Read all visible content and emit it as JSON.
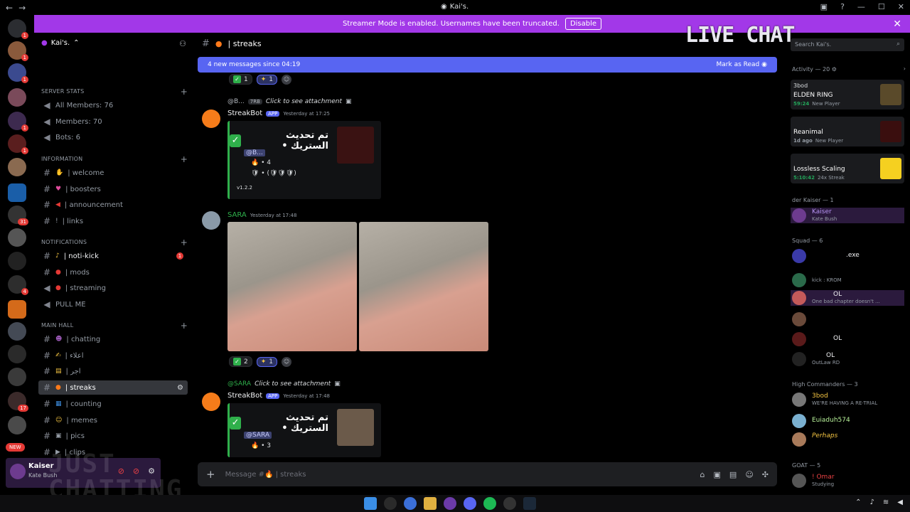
{
  "window": {
    "title": "Kai's.",
    "back": "←",
    "forward": "→"
  },
  "banner": {
    "text": "Streamer Mode is enabled. Usernames have been truncated.",
    "button": "Disable",
    "close": "✕"
  },
  "servers": {
    "new_label": "NEW",
    "badges": [
      "1",
      "1",
      "1",
      "1",
      "1",
      "31",
      "4",
      "17"
    ]
  },
  "guild": {
    "name": "Kai's.",
    "categories": {
      "server_stats": "SERVER STATS",
      "information": "INFORMATION",
      "notifications": "NOTIFICATIONS",
      "main_hall": "MAIN HALL"
    },
    "stats": [
      "All Members: 76",
      "Members: 70",
      "Bots: 6"
    ],
    "info_channels": [
      "| welcome",
      "| boosters",
      "| announcement",
      "| links"
    ],
    "notif_channels": [
      "| noti-kick",
      "| mods",
      "| streaming",
      "PULL ME"
    ],
    "notif_badge": "1",
    "hall_channels": [
      "| chatting",
      "| اعلاء",
      "| اجر",
      "| streaks",
      "| counting",
      "| memes",
      "| pics",
      "| clips"
    ]
  },
  "user": {
    "name": "Kaiser",
    "status": "Kate Bush"
  },
  "watermark": {
    "line1": "JUST",
    "line2": "CHATTING"
  },
  "chat": {
    "channel": "| streaks",
    "new_messages": "4 new messages since 04:19",
    "mark_read": "Mark as Read",
    "placeholder": "Message #🔥 | streaks",
    "react1": {
      "count1": "1",
      "count2": "1"
    },
    "msg1": {
      "reply_user": "@B...",
      "reply_tag": "7RB",
      "reply_text": "Click to see attachment",
      "author": "StreakBot",
      "app": "APP",
      "time": "Yesterday at 17:25",
      "title": "تم تحديث الستريك •",
      "mention": "@B...",
      "line1": "🔥 • 4",
      "line2": "🛡 • (🛡🛡🛡)",
      "version": "v1.2.2"
    },
    "msg2": {
      "author": "SARA",
      "time": "Yesterday at 17:48",
      "count1": "2",
      "count2": "1"
    },
    "msg3": {
      "reply_user": "@SARA",
      "reply_text": "Click to see attachment",
      "author": "StreakBot",
      "app": "APP",
      "time": "Yesterday at 17:48",
      "title": "تم تحديث الستريك •",
      "mention": "@SARA",
      "line1": "🔥 • 3"
    }
  },
  "members": {
    "search_placeholder": "Search Kai's.",
    "live_chat": "LIVE CHAT",
    "activity_header": "Activity — 20",
    "activities": [
      {
        "user": "3bod",
        "game": "ELDEN RING",
        "time": "59:24",
        "note": "New Player"
      },
      {
        "user": "",
        "game": "Reanimal",
        "time": "1d ago",
        "note": "New Player"
      },
      {
        "user": "",
        "game": "Lossless Scaling",
        "time": "5:10:42",
        "note": "24x Streak"
      }
    ],
    "groups": {
      "der_kaiser": "der Kaiser — 1",
      "squad": "Squad — 6",
      "high": "High Commanders — 3",
      "goat": "GOAT — 5"
    },
    "list": [
      {
        "name": "Kaiser",
        "status": "Kate Bush"
      },
      {
        "name": ".exe",
        "status": ""
      },
      {
        "name": "",
        "status": "kick : KROM"
      },
      {
        "name": "OL",
        "status": "One bad chapter doesn't ..."
      },
      {
        "name": "",
        "status": ""
      },
      {
        "name": "OL",
        "status": ""
      },
      {
        "name": "OL",
        "status": "OutLaw RD"
      },
      {
        "name": "3bod",
        "status": "WE'RE HAVING A RE-TRIAL"
      },
      {
        "name": "Euiaduh574",
        "status": ""
      },
      {
        "name": "Perhaps",
        "status": ""
      },
      {
        "name": "! Omar",
        "status": "Studying"
      }
    ]
  },
  "colors": {
    "accent": "#5865f2",
    "banner": "#a238e8",
    "green": "#2fb04b",
    "red": "#e53935"
  }
}
